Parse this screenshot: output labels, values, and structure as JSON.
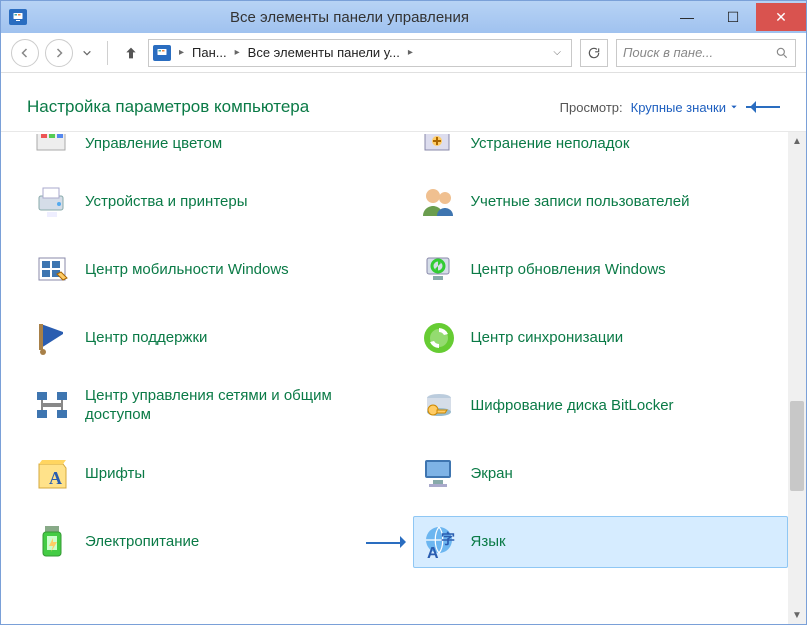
{
  "window": {
    "title": "Все элементы панели управления"
  },
  "breadcrumb": {
    "item1": "Пан...",
    "item2": "Все элементы панели у..."
  },
  "search": {
    "placeholder": "Поиск в пане..."
  },
  "header": {
    "title": "Настройка параметров компьютера",
    "view_label": "Просмотр:",
    "view_value": "Крупные значки"
  },
  "items": {
    "a0": "Управление цветом",
    "b0": "Устранение неполадок",
    "a1": "Устройства и принтеры",
    "b1": "Учетные записи пользователей",
    "a2": "Центр мобильности Windows",
    "b2": "Центр обновления Windows",
    "a3": "Центр поддержки",
    "b3": "Центр синхронизации",
    "a4": "Центр управления сетями и общим доступом",
    "b4": "Шифрование диска BitLocker",
    "a5": "Шрифты",
    "b5": "Экран",
    "a6": "Электропитание",
    "b6": "Язык"
  }
}
